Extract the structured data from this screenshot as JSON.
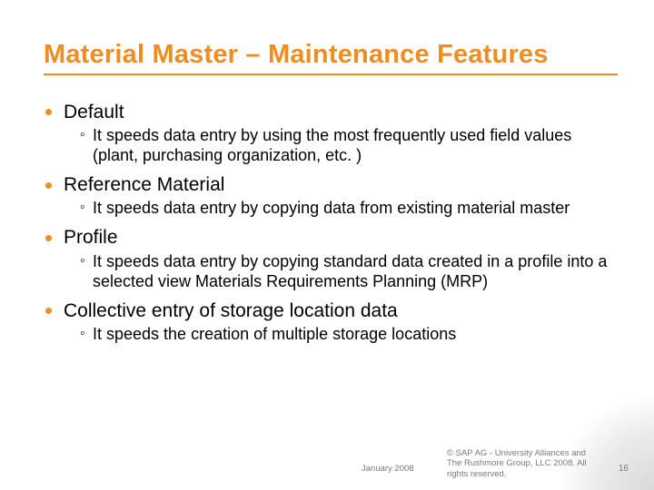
{
  "title": "Material Master – Maintenance Features",
  "items": [
    {
      "label": "Default",
      "sub": "It speeds data entry by using the most frequently used field values (plant, purchasing organization, etc. )"
    },
    {
      "label": "Reference Material",
      "sub": "It speeds data entry by copying data from existing material master"
    },
    {
      "label": "Profile",
      "sub": "It speeds data entry by copying standard data created in a profile into a selected view Materials Requirements Planning (MRP)"
    },
    {
      "label": "Collective entry of storage location data",
      "sub": "It speeds the creation of multiple storage locations"
    }
  ],
  "footer": {
    "date": "January 2008",
    "copyright": "© SAP AG - University Alliances and The Rushmore Group, LLC 2008. All rights reserved.",
    "page": "16"
  }
}
